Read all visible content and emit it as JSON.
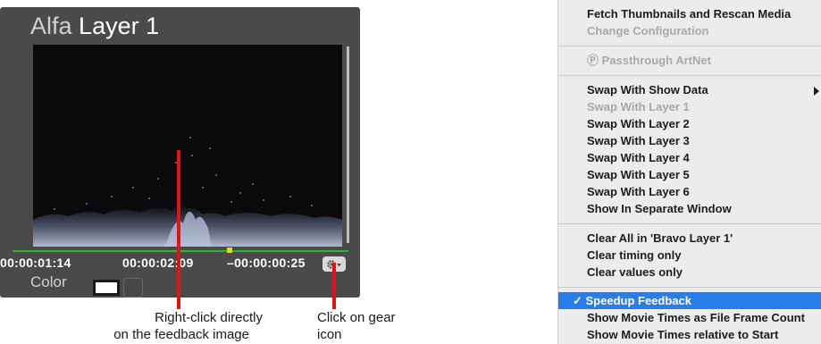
{
  "layer_panel": {
    "title_prefix": "Alfa",
    "title_name": "Layer 1",
    "times": [
      "00:00:01:14",
      "00:00:02:09",
      "–00:00:00:25"
    ],
    "color_label": "Color",
    "gear_icon": "gear-icon"
  },
  "annotations": {
    "feedback": [
      "Right-click directly",
      "on the feedback image"
    ],
    "gear": [
      "Click on gear",
      "icon"
    ]
  },
  "context_menu": {
    "items": [
      {
        "label": "Fetch Thumbnails and Rescan Media",
        "enabled": true
      },
      {
        "label": "Change Configuration",
        "enabled": false
      },
      {
        "label": "Ⓟ Passthrough ArtNet",
        "enabled": false
      },
      {
        "label": "Swap With Show Data",
        "enabled": true,
        "submenu": true
      },
      {
        "label": "Swap With Layer 1",
        "enabled": false
      },
      {
        "label": "Swap With Layer 2",
        "enabled": true
      },
      {
        "label": "Swap With Layer 3",
        "enabled": true
      },
      {
        "label": "Swap With Layer 4",
        "enabled": true
      },
      {
        "label": "Swap With Layer 5",
        "enabled": true
      },
      {
        "label": "Swap With Layer 6",
        "enabled": true
      },
      {
        "label": "Show In Separate Window",
        "enabled": true
      },
      {
        "label": "Clear All in 'Bravo Layer 1'",
        "enabled": true
      },
      {
        "label": "Clear timing only",
        "enabled": true
      },
      {
        "label": "Clear values only",
        "enabled": true
      },
      {
        "label": "✓ Speedup Feedback",
        "enabled": true,
        "checked": true,
        "highlighted": true
      },
      {
        "label": "Show Movie Times as File Frame Count",
        "enabled": true
      },
      {
        "label": "Show Movie Times relative to Start",
        "enabled": true
      }
    ],
    "highlight_color": "#2a7ce8"
  }
}
